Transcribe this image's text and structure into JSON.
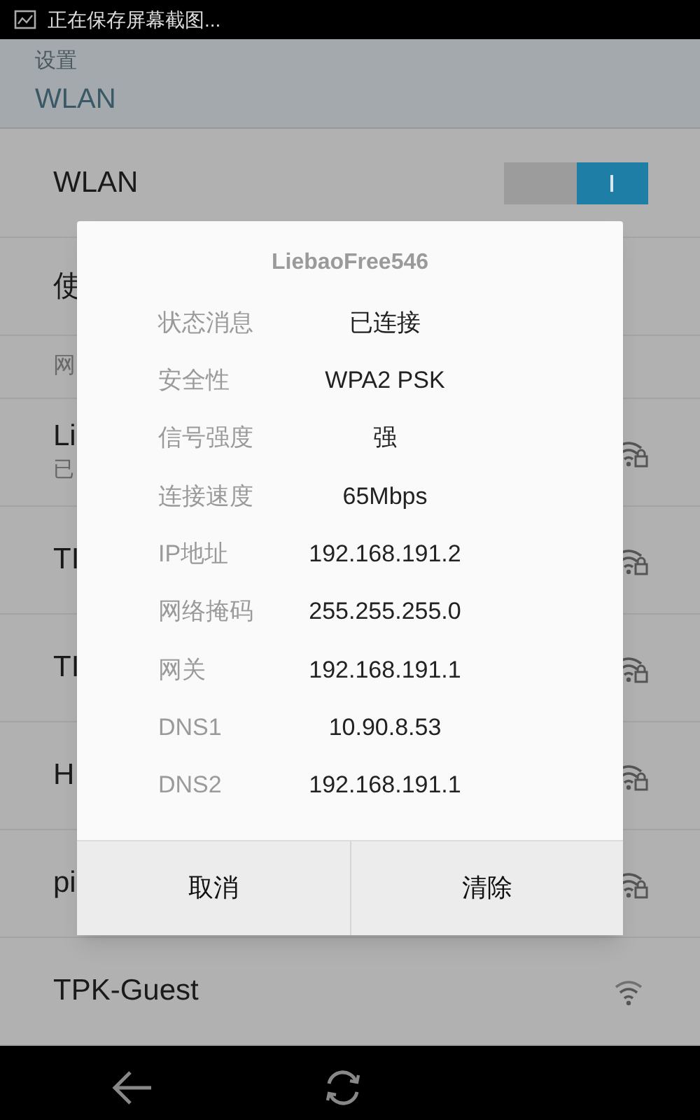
{
  "status_bar": {
    "notification": "正在保存屏幕截图..."
  },
  "header": {
    "breadcrumb": "设置",
    "title": "WLAN"
  },
  "wlan_switch": {
    "label": "WLAN",
    "on": true
  },
  "list": [
    {
      "kind": "item",
      "title": "使"
    },
    {
      "kind": "section",
      "title": "网"
    },
    {
      "kind": "network",
      "title": "Li",
      "subtitle": "已",
      "locked": true
    },
    {
      "kind": "network",
      "title": "TI",
      "locked": true
    },
    {
      "kind": "network",
      "title": "TI",
      "locked": true
    },
    {
      "kind": "network",
      "title": "H",
      "locked": true
    },
    {
      "kind": "network",
      "title": "pi",
      "locked": true
    },
    {
      "kind": "network",
      "title": "TPK-Guest",
      "locked": false
    }
  ],
  "dialog": {
    "title": "LiebaoFree546",
    "rows": [
      {
        "label": "状态消息",
        "value": "已连接"
      },
      {
        "label": "安全性",
        "value": "WPA2 PSK"
      },
      {
        "label": "信号强度",
        "value": "强"
      },
      {
        "label": "连接速度",
        "value": "65Mbps"
      },
      {
        "label": "IP地址",
        "value": "192.168.191.2"
      },
      {
        "label": "网络掩码",
        "value": "255.255.255.0"
      },
      {
        "label": "网关",
        "value": "192.168.191.1"
      },
      {
        "label": "DNS1",
        "value": "10.90.8.53"
      },
      {
        "label": "DNS2",
        "value": "192.168.191.1"
      }
    ],
    "buttons": [
      "取消",
      "清除"
    ]
  }
}
